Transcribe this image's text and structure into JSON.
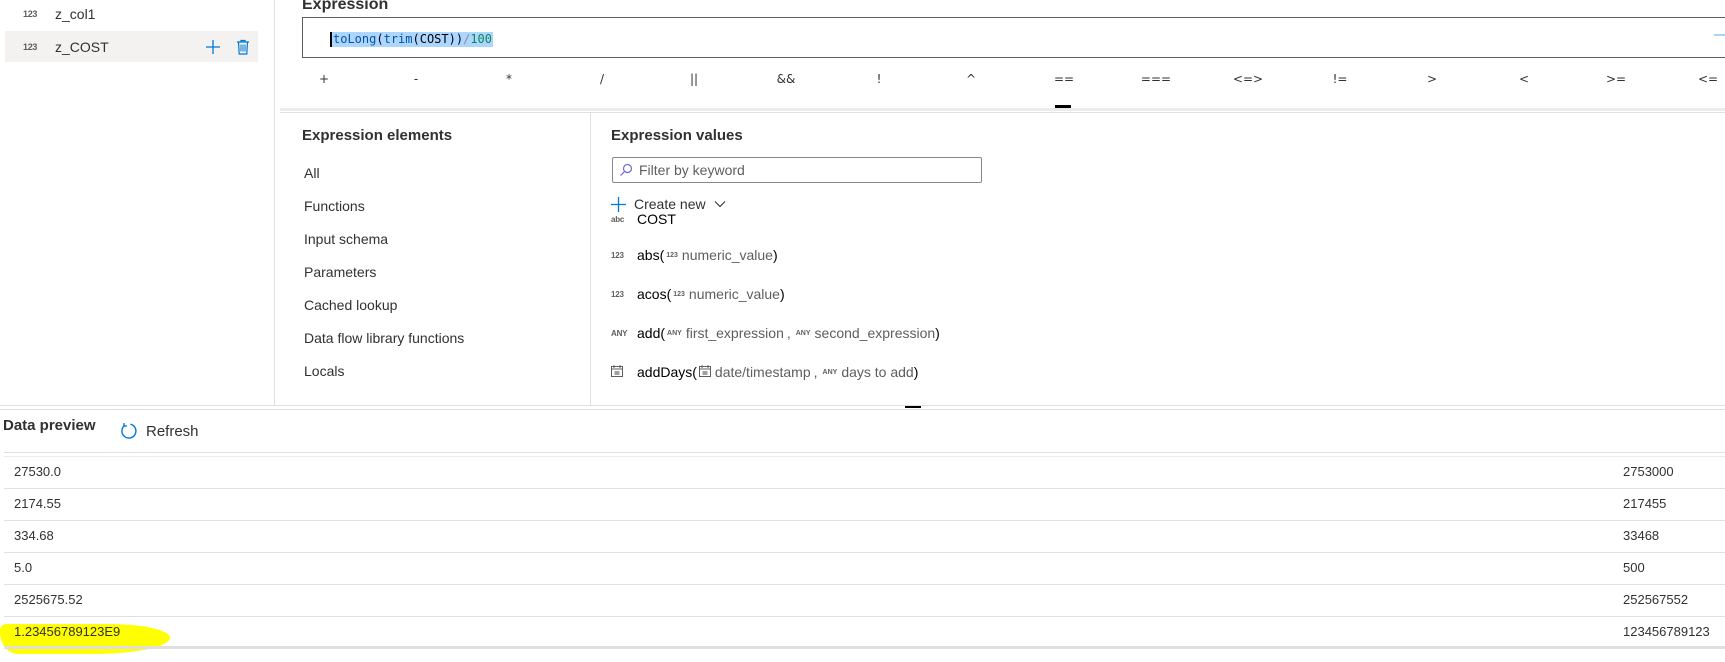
{
  "columns_list": [
    {
      "type": "123",
      "name": "z_col1",
      "selected": false
    },
    {
      "type": "123",
      "name": "z_COST",
      "selected": true,
      "actions": [
        "add-icon",
        "delete-icon"
      ]
    }
  ],
  "expression": {
    "label": "Expression",
    "code_parts": {
      "fn1": "toLong",
      "p1": "(",
      "fn2": "trim",
      "p2": "(",
      "arg": "COST",
      "p3": "))",
      "op": "/",
      "num": "100"
    },
    "full_text": "toLong(trim(COST))/100"
  },
  "operators": [
    "+",
    "-",
    "*",
    "/",
    "||",
    "&&",
    "!",
    "^",
    "==",
    "===",
    "<=>",
    "!=",
    ">",
    "<",
    ">=",
    "<="
  ],
  "active_operator": "==",
  "expression_elements": {
    "title": "Expression elements",
    "items": [
      "All",
      "Functions",
      "Input schema",
      "Parameters",
      "Cached lookup",
      "Data flow library functions",
      "Locals"
    ]
  },
  "expression_values": {
    "title": "Expression values",
    "filter_placeholder": "Filter by keyword",
    "create_new_label": "Create new",
    "items": [
      {
        "type": "abc",
        "name": "COST"
      },
      {
        "type": "123",
        "name": "abs(",
        "params": [
          {
            "type": "123",
            "name": "numeric_value"
          }
        ],
        "close": ")"
      },
      {
        "type": "123",
        "name": "acos(",
        "params": [
          {
            "type": "123",
            "name": "numeric_value"
          }
        ],
        "close": ")"
      },
      {
        "type": "ANY",
        "name": "add(",
        "params": [
          {
            "type": "ANY",
            "name": "first_expression"
          },
          {
            "type": "ANY",
            "name": "second_expression"
          }
        ],
        "close": ")"
      },
      {
        "type": "calendar-icon",
        "name": "addDays(",
        "params": [
          {
            "type": "calendar-icon",
            "name": "date/timestamp"
          },
          {
            "type": "ANY",
            "name": "days to add"
          }
        ],
        "close": ")"
      }
    ]
  },
  "data_preview": {
    "title": "Data preview",
    "refresh_label": "Refresh",
    "rows": [
      {
        "c1": "27530.0",
        "c2": "2753000"
      },
      {
        "c1": "2174.55",
        "c2": "217455"
      },
      {
        "c1": "334.68",
        "c2": "33468"
      },
      {
        "c1": "5.0",
        "c2": "500"
      },
      {
        "c1": "2525675.52",
        "c2": "252567552"
      },
      {
        "c1": "1.23456789123E9",
        "c2": "123456789123",
        "highlighted": true
      }
    ]
  },
  "colors": {
    "accent": "#0078d4",
    "selection": "#add6ff",
    "highlight": "#ffff00"
  }
}
